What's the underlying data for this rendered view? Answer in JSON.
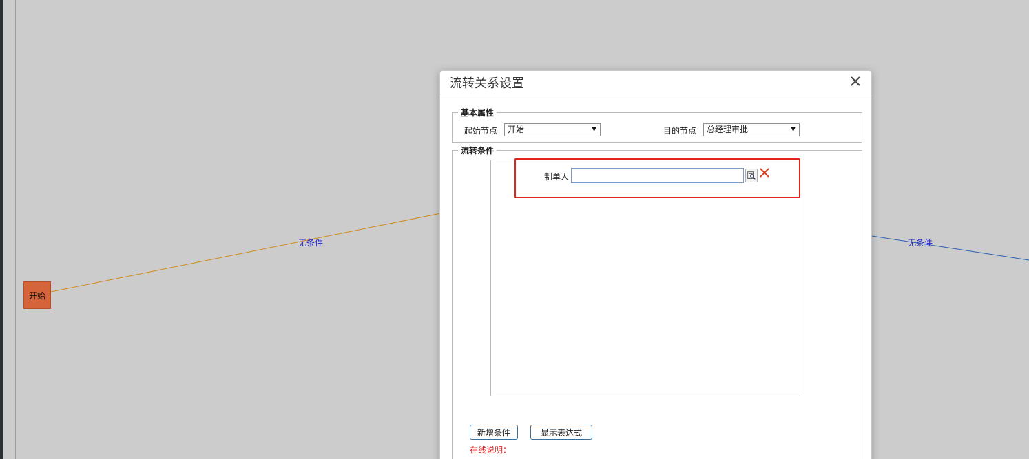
{
  "canvas": {
    "start_node_label": "开始",
    "edge_label_left": "无条件",
    "edge_label_right": "无条件"
  },
  "dialog": {
    "title": "流转关系设置",
    "basic": {
      "legend": "基本属性",
      "start_label": "起始节点",
      "start_value": "开始",
      "target_label": "目的节点",
      "target_value": "总经理审批"
    },
    "conditions": {
      "legend": "流转条件",
      "creator_label": "制单人",
      "creator_value": ""
    },
    "buttons": {
      "add_condition": "新增条件",
      "show_expression": "显示表达式"
    },
    "notes": {
      "title": "在线说明："
    }
  },
  "colors": {
    "canvas_bg": "#cccccc",
    "start_node": "#d5643a",
    "edge_left": "#d08a1a",
    "edge_right": "#2a5fb0",
    "highlight": "#e1251b",
    "note_text": "#e02020"
  }
}
